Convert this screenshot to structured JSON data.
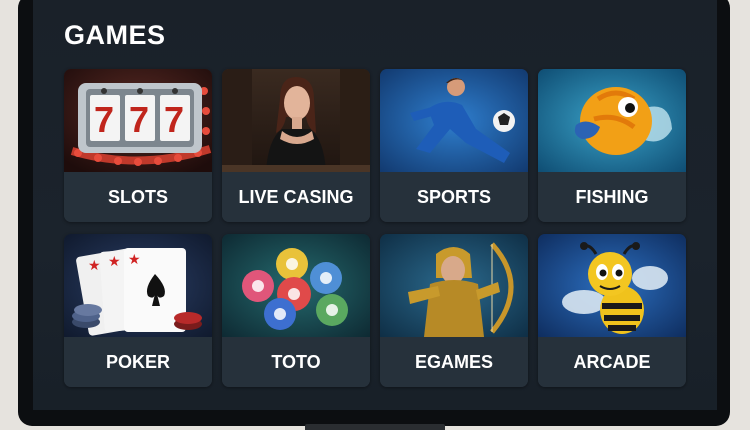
{
  "section": {
    "title": "GAMES"
  },
  "games": [
    {
      "label": "SLOTS",
      "icon": "slot-machine-icon"
    },
    {
      "label": "LIVE CASING",
      "icon": "live-dealer-icon"
    },
    {
      "label": "SPORTS",
      "icon": "soccer-player-icon"
    },
    {
      "label": "FISHING",
      "icon": "fish-icon"
    },
    {
      "label": "POKER",
      "icon": "playing-cards-icon"
    },
    {
      "label": "TOTO",
      "icon": "lottery-balls-icon"
    },
    {
      "label": "EGAMES",
      "icon": "archer-icon"
    },
    {
      "label": "ARCADE",
      "icon": "bee-icon"
    }
  ],
  "colors": {
    "screen_bg": "#1b232c",
    "card_bg": "#242e38",
    "text": "#ffffff"
  }
}
